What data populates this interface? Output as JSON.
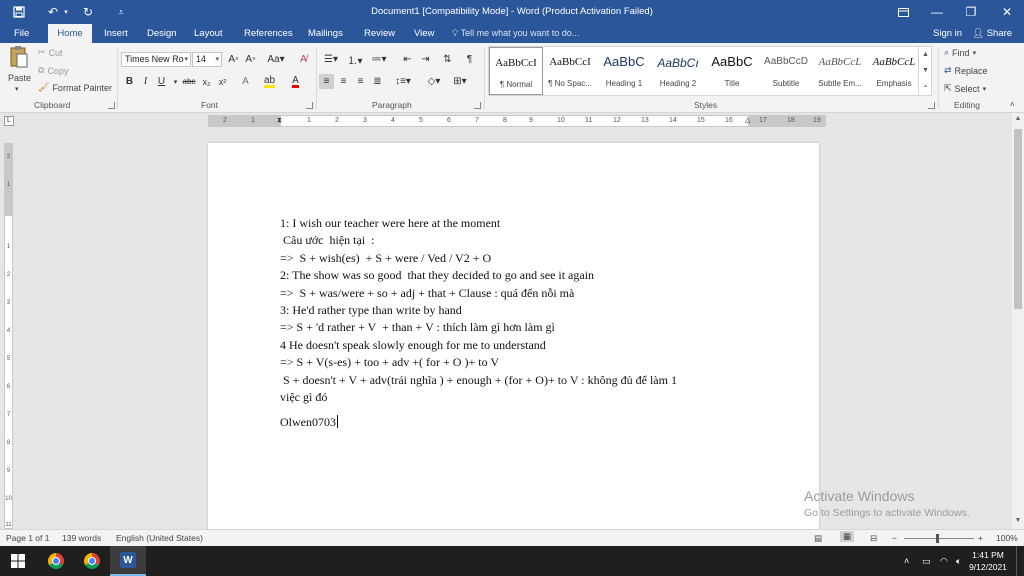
{
  "window": {
    "title": "Document1 [Compatibility Mode] - Word (Product Activation Failed)"
  },
  "titlebar": {
    "save_icon": "save-icon",
    "undo_icon": "undo-icon",
    "redo_icon": "redo-icon",
    "customize_icon": "customize-icon"
  },
  "tabs": [
    {
      "label": "File"
    },
    {
      "label": "Home",
      "active": true
    },
    {
      "label": "Insert"
    },
    {
      "label": "Design"
    },
    {
      "label": "Layout"
    },
    {
      "label": "References"
    },
    {
      "label": "Mailings"
    },
    {
      "label": "Review"
    },
    {
      "label": "View"
    }
  ],
  "tell_me": "Tell me what you want to do...",
  "account": {
    "sign_in": "Sign in",
    "share": "Share"
  },
  "clipboard": {
    "paste": "Paste",
    "cut": "Cut",
    "copy": "Copy",
    "format_painter": "Format Painter",
    "label": "Clipboard"
  },
  "font": {
    "name": "Times New Ro",
    "size": "14",
    "label": "Font",
    "bold": "B",
    "italic": "I",
    "underline": "U",
    "strike": "abc",
    "sub": "x₂",
    "sup": "x²"
  },
  "paragraph": {
    "label": "Paragraph"
  },
  "styles": {
    "label": "Styles",
    "items": [
      {
        "preview": "AaBbCcI",
        "name": "¶ Normal"
      },
      {
        "preview": "AaBbCcI",
        "name": "¶ No Spac..."
      },
      {
        "preview": "AaBbC",
        "name": "Heading 1"
      },
      {
        "preview": "AaBbCı",
        "name": "Heading 2"
      },
      {
        "preview": "AaBbC",
        "name": "Title"
      },
      {
        "preview": "AaBbCcD",
        "name": "Subtitle"
      },
      {
        "preview": "AaBbCcL",
        "name": "Subtle Em..."
      },
      {
        "preview": "AaBbCcL",
        "name": "Emphasis"
      }
    ]
  },
  "editing": {
    "find": "Find",
    "replace": "Replace",
    "select": "Select",
    "label": "Editing"
  },
  "ruler": {
    "labels": [
      "2",
      "1",
      "1",
      "2",
      "3",
      "4",
      "5",
      "6",
      "7",
      "8",
      "9",
      "10",
      "11",
      "12",
      "13",
      "14",
      "15",
      "16",
      "17",
      "18",
      "19"
    ]
  },
  "vruler": {
    "labels": [
      "2",
      "1",
      "1",
      "2",
      "3",
      "4",
      "5",
      "6",
      "7",
      "8",
      "9",
      "10",
      "11"
    ]
  },
  "document": {
    "lines": [
      "1: I wish our teacher were here at the moment",
      " Câu ước  hiện tại  :",
      "=>  S + wish(es)  + S + were / Ved / V2 + O",
      "2: The show was so good  that they decided to go and see it again",
      "=>  S + was/were + so + adj + that + Clause : quá đến nỗi mà",
      "3: He'd rather type than write by hand",
      "=> S + 'd rather + V  + than + V : thích làm gì hơn làm gì",
      "4 He doesn't speak slowly enough for me to understand",
      "=> S + V(s-es) + too + adv +( for + O )+ to V",
      " S + doesn't + V + adv(trái nghĩa ) + enough + (for + O)+ to V : không đủ để làm 1",
      "việc gì đó"
    ],
    "signature": "Olwen0703"
  },
  "watermark": {
    "title": "Activate Windows",
    "subtitle": "Go to Settings to activate Windows."
  },
  "status": {
    "page": "Page 1 of 1",
    "words": "139 words",
    "language": "English (United States)",
    "zoom": "100%"
  },
  "taskbar": {
    "time": "1:41 PM",
    "date": "9/12/2021"
  },
  "colors": {
    "word_blue": "#2b579a",
    "ribbon_bg": "#f3f3f3",
    "taskbar_bg": "#1f1f1f"
  }
}
